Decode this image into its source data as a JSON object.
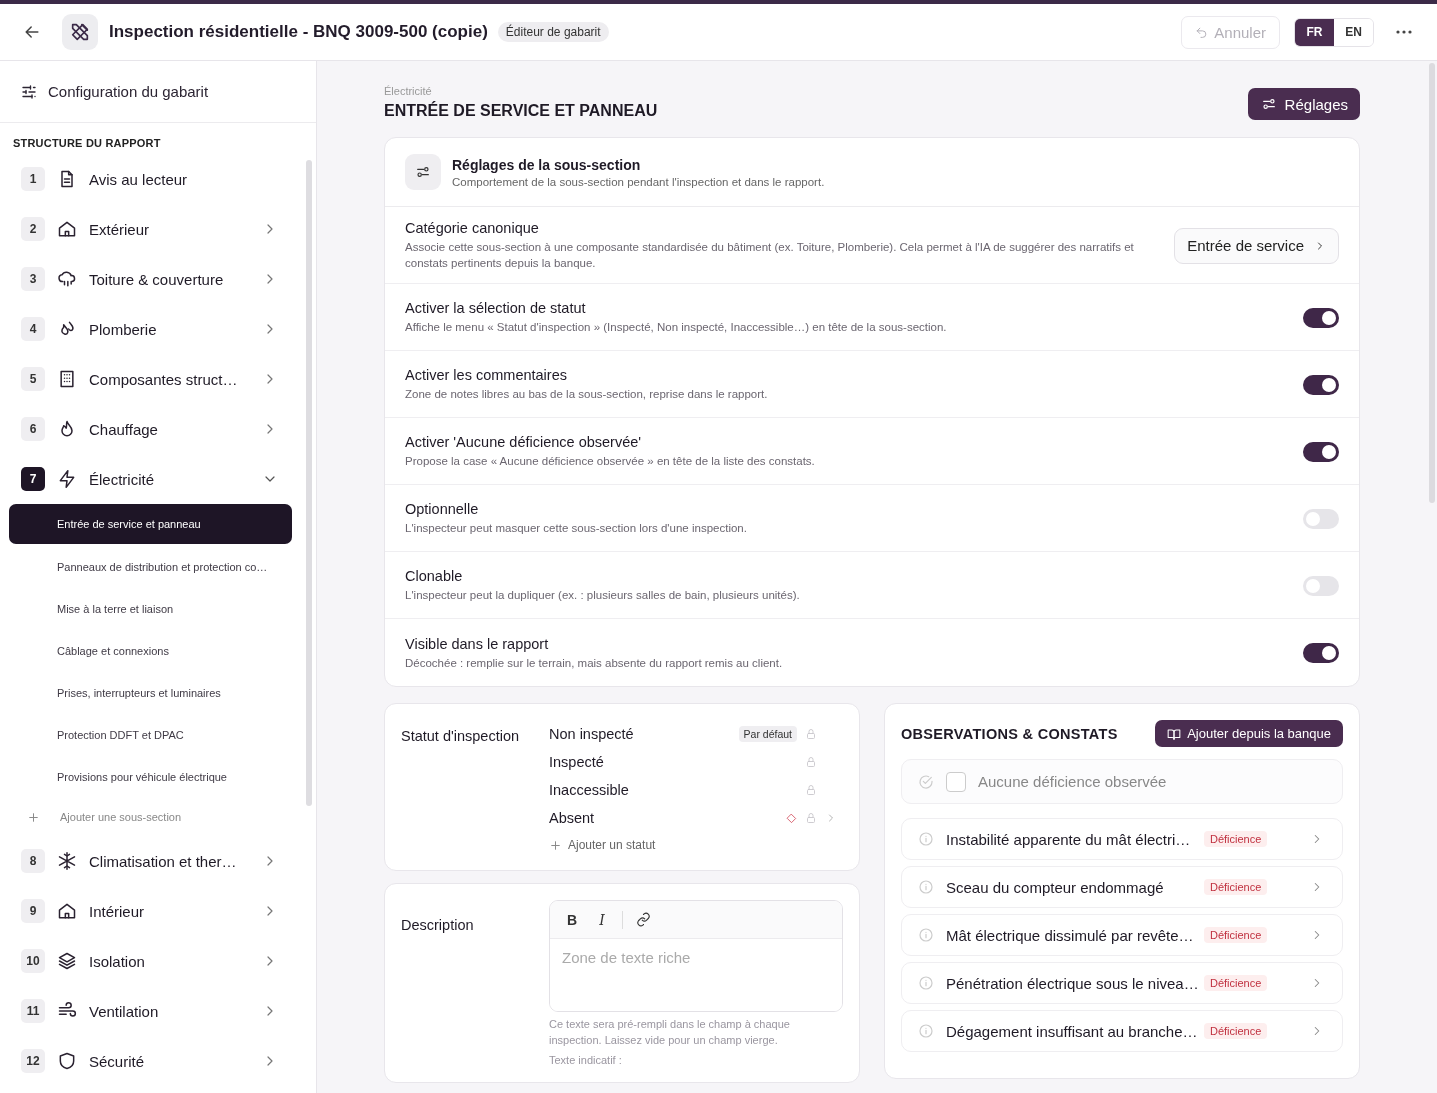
{
  "header": {
    "title": "Inspection résidentielle - BNQ 3009-500 (copie)",
    "badge": "Éditeur de gabarit",
    "undo": "Annuler",
    "languages": [
      {
        "label": "FR",
        "selected": true
      },
      {
        "label": "EN",
        "selected": false
      }
    ]
  },
  "sidebar": {
    "title": "Configuration du gabarit",
    "heading": "STRUCTURE DU RAPPORT",
    "sections": [
      {
        "number": "1",
        "label": "Avis au lecteur",
        "expandable": false,
        "expanded": false,
        "selected": false
      },
      {
        "number": "2",
        "label": "Extérieur",
        "expandable": true,
        "expanded": false,
        "selected": false
      },
      {
        "number": "3",
        "label": "Toiture & couverture",
        "expandable": true,
        "expanded": false,
        "selected": false
      },
      {
        "number": "4",
        "label": "Plomberie",
        "expandable": true,
        "expanded": false,
        "selected": false
      },
      {
        "number": "5",
        "label": "Composantes struct…",
        "expandable": true,
        "expanded": false,
        "selected": false
      },
      {
        "number": "6",
        "label": "Chauffage",
        "expandable": true,
        "expanded": false,
        "selected": false
      },
      {
        "number": "7",
        "label": "Électricité",
        "expandable": true,
        "expanded": true,
        "selected": true,
        "children": [
          {
            "label": "Entrée de service et panneau",
            "selected": true
          },
          {
            "label": "Panneaux de distribution et protection co…",
            "selected": false
          },
          {
            "label": "Mise à la terre et liaison",
            "selected": false
          },
          {
            "label": "Câblage et connexions",
            "selected": false
          },
          {
            "label": "Prises, interrupteurs et luminaires",
            "selected": false
          },
          {
            "label": "Protection DDFT et DPAC",
            "selected": false
          },
          {
            "label": "Provisions pour véhicule électrique",
            "selected": false
          }
        ],
        "add_label": "Ajouter une sous-section"
      },
      {
        "number": "8",
        "label": "Climatisation et ther…",
        "expandable": true,
        "expanded": false,
        "selected": false
      },
      {
        "number": "9",
        "label": "Intérieur",
        "expandable": true,
        "expanded": false,
        "selected": false
      },
      {
        "number": "10",
        "label": "Isolation",
        "expandable": true,
        "expanded": false,
        "selected": false
      },
      {
        "number": "11",
        "label": "Ventilation",
        "expandable": true,
        "expanded": false,
        "selected": false
      },
      {
        "number": "12",
        "label": "Sécurité",
        "expandable": true,
        "expanded": false,
        "selected": false
      }
    ]
  },
  "main": {
    "breadcrumb": "Électricité",
    "title": "ENTRÉE DE SERVICE ET PANNEAU",
    "settings_button": "Réglages",
    "settings_card": {
      "title": "Réglages de la sous-section",
      "subtitle": "Comportement de la sous-section pendant l'inspection et dans le rapport.",
      "rows": [
        {
          "kind": "select",
          "label": "Catégorie canonique",
          "description": "Associe cette sous-section à une composante standardisée du bâtiment (ex. Toiture, Plomberie). Cela permet à l'IA de suggérer des narratifs et constats pertinents depuis la banque.",
          "value": "Entrée de service"
        },
        {
          "kind": "toggle",
          "label": "Activer la sélection de statut",
          "description": "Affiche le menu « Statut d'inspection » (Inspecté, Non inspecté, Inaccessible…) en tête de la sous-section.",
          "on": true
        },
        {
          "kind": "toggle",
          "label": "Activer les commentaires",
          "description": "Zone de notes libres au bas de la sous-section, reprise dans le rapport.",
          "on": true
        },
        {
          "kind": "toggle",
          "label": "Activer 'Aucune déficience observée'",
          "description": "Propose la case « Aucune déficience observée » en tête de la liste des constats.",
          "on": true
        },
        {
          "kind": "toggle",
          "label": "Optionnelle",
          "description": "L'inspecteur peut masquer cette sous-section lors d'une inspection.",
          "on": false
        },
        {
          "kind": "toggle",
          "label": "Clonable",
          "description": "L'inspecteur peut la dupliquer (ex. : plusieurs salles de bain, plusieurs unités).",
          "on": false
        },
        {
          "kind": "toggle",
          "label": "Visible dans le rapport",
          "description": "Décochée : remplie sur le terrain, mais absente du rapport remis au client.",
          "on": true
        }
      ]
    },
    "status_card": {
      "label": "Statut d'inspection",
      "statuses": [
        {
          "label": "Non inspecté",
          "badge": "Par défaut",
          "alert": false
        },
        {
          "label": "Inspecté",
          "alert": false
        },
        {
          "label": "Inaccessible",
          "alert": false
        },
        {
          "label": "Absent",
          "alert": true
        }
      ],
      "add_label": "Ajouter un statut"
    },
    "description_card": {
      "label": "Description",
      "placeholder": "Zone de texte riche",
      "toolbar": [
        "B",
        "I"
      ],
      "help": "Ce texte sera pré-rempli dans le champ à chaque inspection. Laissez vide pour un champ vierge.",
      "next_label": "Texte indicatif :"
    },
    "observations": {
      "title": "OBSERVATIONS & CONSTATS",
      "add_button": "Ajouter depuis la banque",
      "none_row": {
        "label": "Aucune déficience observée",
        "checked": false
      },
      "items": [
        {
          "label": "Instabilité apparente du mât électri…",
          "tag": "Déficience"
        },
        {
          "label": "Sceau du compteur endommagé",
          "tag": "Déficience"
        },
        {
          "label": "Mât électrique dissimulé par revête…",
          "tag": "Déficience"
        },
        {
          "label": "Pénétration électrique sous le nivea…",
          "tag": "Déficience"
        },
        {
          "label": "Dégagement insuffisant au branche…",
          "tag": "Déficience"
        }
      ]
    }
  }
}
